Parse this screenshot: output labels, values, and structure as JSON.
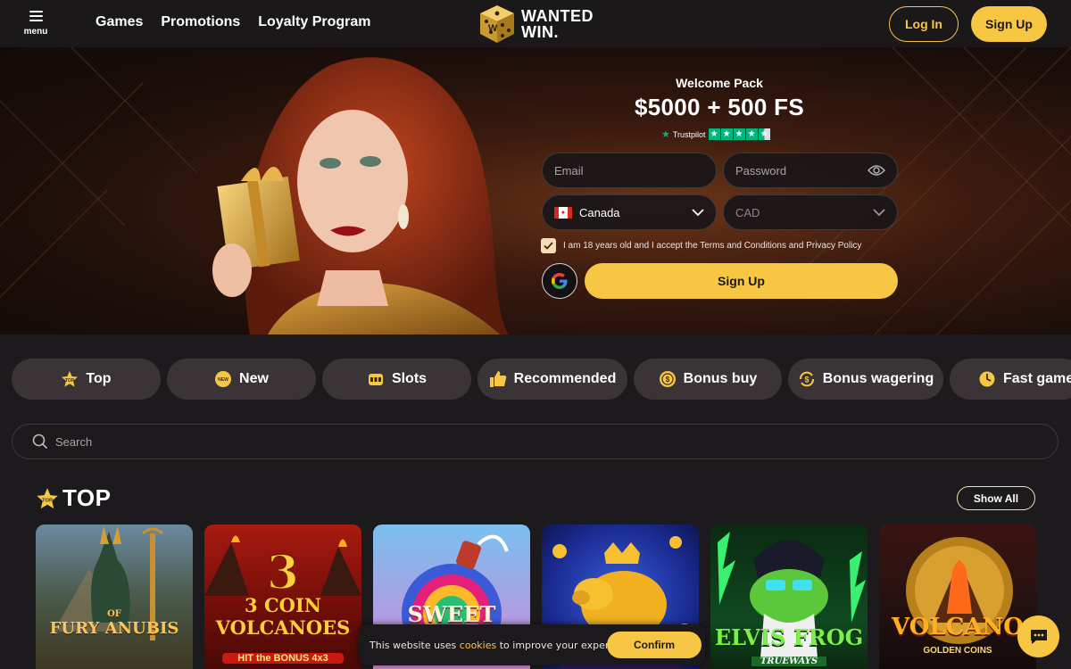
{
  "header": {
    "menu_label": "menu",
    "nav": [
      "Games",
      "Promotions",
      "Loyalty Program"
    ],
    "logo_line1": "WANTED",
    "logo_line2": "WIN.",
    "login_label": "Log In",
    "signup_label": "Sign Up"
  },
  "hero": {
    "welcome": "Welcome Pack",
    "amount": "$5000 + 500 FS",
    "trustpilot": "Trustpilot",
    "trustpilot_rating": 4.5,
    "email_placeholder": "Email",
    "password_placeholder": "Password",
    "country": "Canada",
    "currency": "CAD",
    "terms": "I am 18 years old and I accept the Terms and Conditions and Privacy Policy",
    "terms_checked": true,
    "signup_label": "Sign Up"
  },
  "categories": [
    {
      "label": "Top",
      "icon": "top-icon"
    },
    {
      "label": "New",
      "icon": "new-icon"
    },
    {
      "label": "Slots",
      "icon": "slots-icon"
    },
    {
      "label": "Recommended",
      "icon": "thumbs-up-icon"
    },
    {
      "label": "Bonus buy",
      "icon": "coin-icon"
    },
    {
      "label": "Bonus wagering",
      "icon": "wagering-icon"
    },
    {
      "label": "Fast games",
      "icon": "clock-icon"
    }
  ],
  "search": {
    "placeholder": "Search"
  },
  "section": {
    "title": "TOP",
    "badge": "TOP",
    "show_all": "Show All"
  },
  "games": [
    {
      "title": "FURY ANUBIS",
      "subtitle": "OF"
    },
    {
      "title": "3 COIN VOLCANOES",
      "subtitle": "HIT the BONUS 4x3"
    },
    {
      "title": "SWEET",
      "subtitle": ""
    },
    {
      "title": "",
      "subtitle": ""
    },
    {
      "title": "ELVIS FROG",
      "subtitle": "TRUEWAYS"
    },
    {
      "title": "VOLCANO",
      "subtitle": "GOLDEN COINS"
    }
  ],
  "cookie": {
    "text_before": "This website uses ",
    "link": "cookies",
    "text_after": " to improve your experience.",
    "confirm": "Confirm"
  },
  "colors": {
    "accent": "#f7c744",
    "background": "#1c1a1c",
    "pill": "#3a3436",
    "trustpilot": "#00b67a"
  }
}
